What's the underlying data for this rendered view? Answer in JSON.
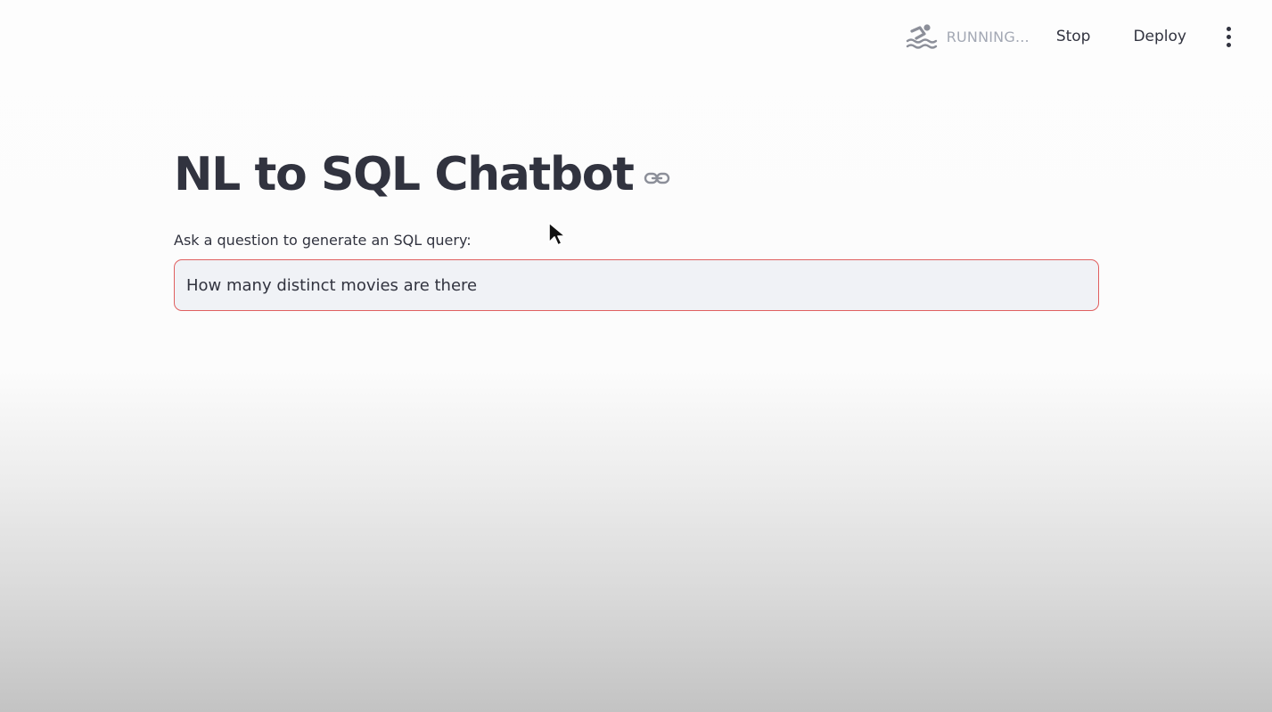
{
  "header": {
    "status_text": "RUNNING...",
    "status_icon": "swimmer-icon",
    "stop_label": "Stop",
    "deploy_label": "Deploy",
    "menu_icon": "kebab-menu-icon"
  },
  "main": {
    "title": "NL to SQL Chatbot",
    "title_anchor_icon": "link-icon",
    "question_label": "Ask a question to generate an SQL query:",
    "question_value": "How many distinct movies are there"
  },
  "colors": {
    "text": "#31333f",
    "status_text": "#a3a8b4",
    "input_border_focus": "#e06060",
    "input_background": "#f0f2f6"
  }
}
